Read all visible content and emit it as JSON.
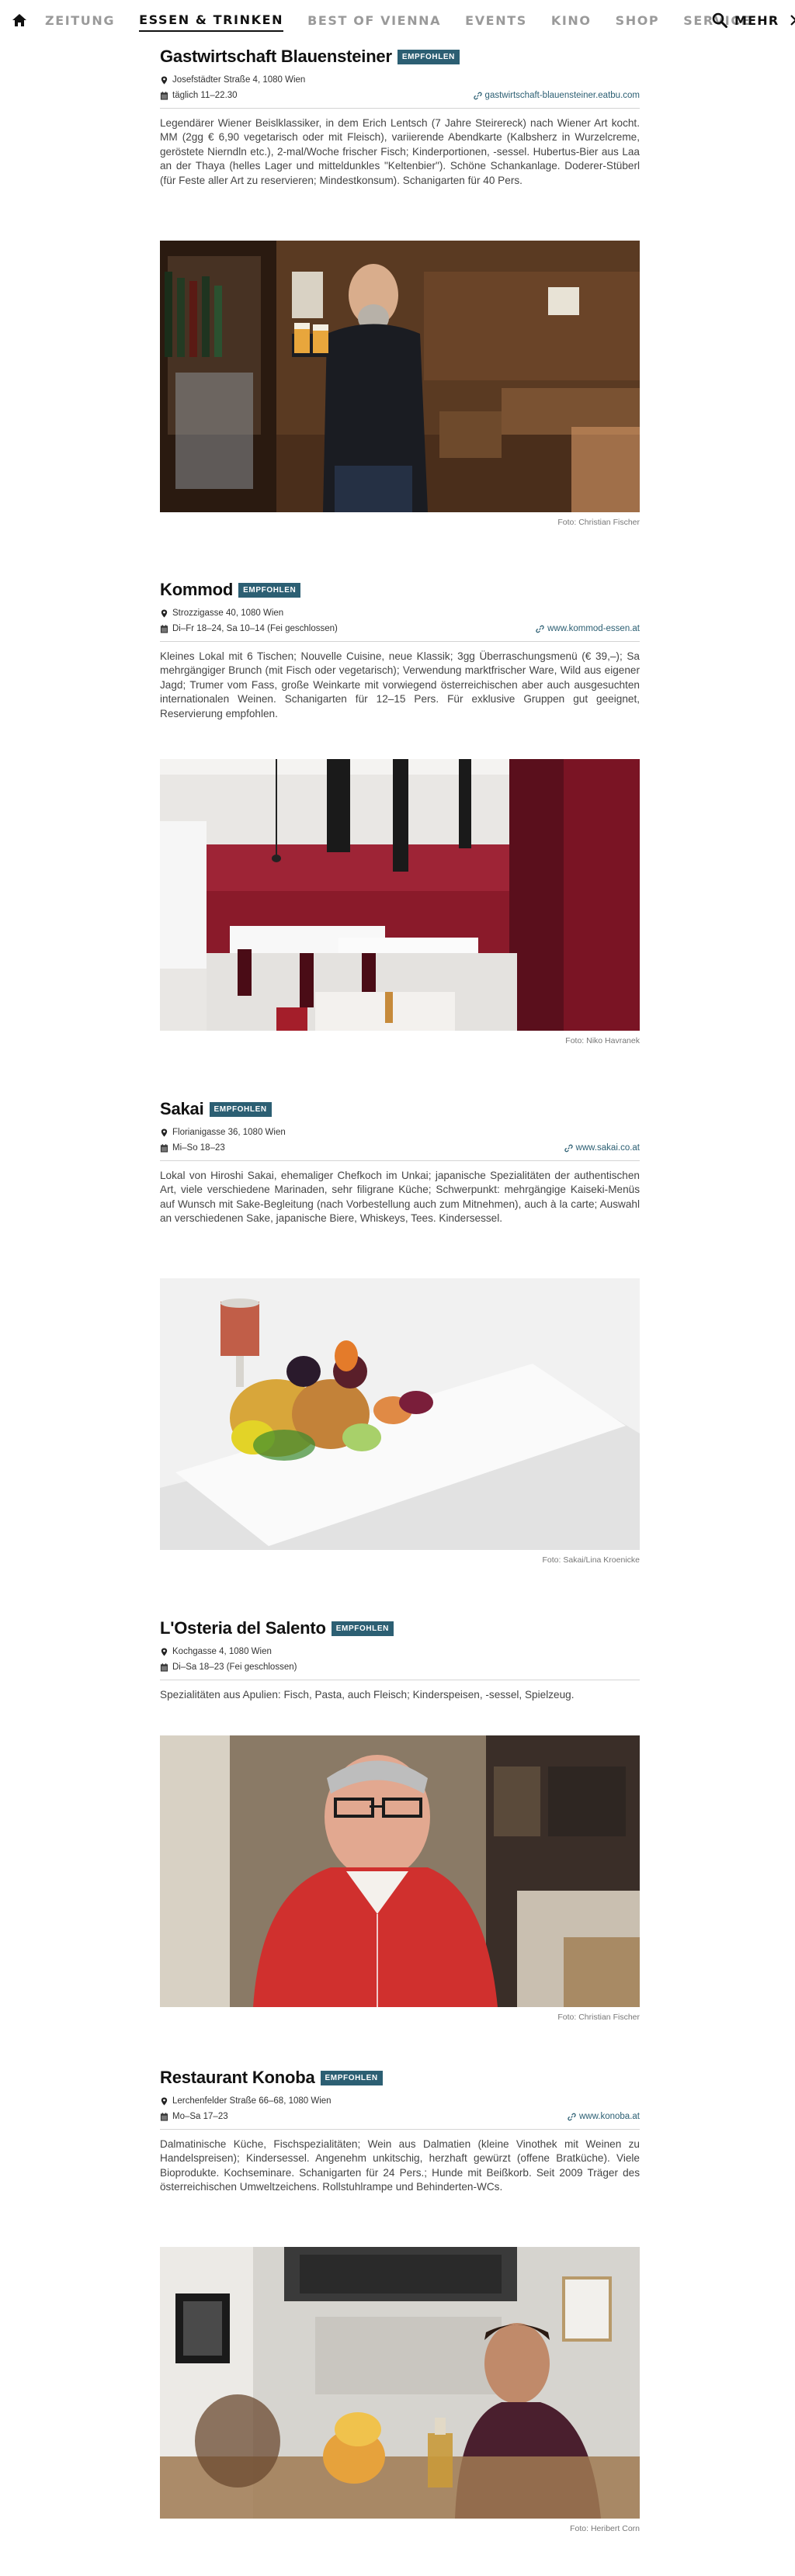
{
  "nav": {
    "items": [
      {
        "label": "ZEITUNG",
        "active": false
      },
      {
        "label": "ESSEN & TRINKEN",
        "active": true
      },
      {
        "label": "BEST OF VIENNA",
        "active": false
      },
      {
        "label": "EVENTS",
        "active": false
      },
      {
        "label": "KINO",
        "active": false
      },
      {
        "label": "SHOP",
        "active": false
      },
      {
        "label": "SERVICE",
        "active": false
      }
    ],
    "more_label": "MEHR",
    "icons": {
      "home": "home-icon",
      "search": "search-icon",
      "more": "chevron-right-icon"
    }
  },
  "colors": {
    "badge": "#2c5f73",
    "link": "#2c5f73",
    "nav_inactive": "#9a9a9a",
    "nav_active": "#111111"
  },
  "entries": [
    {
      "name": "Gastwirtschaft Blauensteiner",
      "badge": "EMPFOHLEN",
      "address": "Josefstädter Straße 4, 1080 Wien",
      "hours": "täglich 11–22.30",
      "website": "gastwirtschaft-blauensteiner.eatbu.com",
      "description": "Legendärer Wiener Beislklassiker, in dem Erich Lentsch (7 Jahre Steirereck) nach Wiener Art kocht. MM (2gg € 6,90 vegetarisch oder mit Fleisch), variierende Abendkarte (Kalbsherz in Wurzelcreme, geröstete Nierndln etc.), 2-mal/Woche frischer Fisch; Kinderportionen, -sessel. Hubertus-Bier aus Laa an der Thaya (helles Lager und mitteldunkles \"Keltenbier\"). Schöne Schankanlage. Doderer-Stüberl (für Feste aller Art zu reservieren; Mindestkonsum). Schanigarten für 40 Pers.",
      "photo_credit": "Foto: Christian Fischer"
    },
    {
      "name": "Kommod",
      "badge": "EMPFOHLEN",
      "address": "Strozzigasse 40, 1080 Wien",
      "hours": "Di–Fr 18–24, Sa 10–14 (Fei geschlossen)",
      "website": "www.kommod-essen.at",
      "description": "Kleines Lokal mit 6 Tischen; Nouvelle Cuisine, neue Klassik; 3gg Überraschungsmenü (€ 39,–); Sa mehrgängiger Brunch (mit Fisch oder vegetarisch); Verwendung marktfrischer Ware, Wild aus eigener Jagd; Trumer vom Fass, große Weinkarte mit vorwiegend österreichischen aber auch ausgesuchten internationalen Weinen. Schanigarten für 12–15 Pers. Für exklusive Gruppen gut geeignet, Reservierung empfohlen.",
      "photo_credit": "Foto: Niko Havranek"
    },
    {
      "name": "Sakai",
      "badge": "EMPFOHLEN",
      "address": "Florianigasse 36, 1080 Wien",
      "hours": "Mi–So 18–23",
      "website": "www.sakai.co.at",
      "description": "Lokal von Hiroshi Sakai, ehemaliger Chefkoch im Unkai; japanische Spezialitäten der authentischen Art, viele verschiedene Marinaden, sehr filigrane Küche; Schwerpunkt: mehrgängige Kaiseki-Menüs auf Wunsch mit Sake-Begleitung (nach Vorbestellung auch zum Mitnehmen), auch à la carte; Auswahl an verschiedenen Sake, japanische Biere, Whiskeys, Tees. Kindersessel.",
      "photo_credit": "Foto: Sakai/Lina Kroenicke"
    },
    {
      "name": "L'Osteria del Salento",
      "badge": "EMPFOHLEN",
      "address": "Kochgasse 4, 1080 Wien",
      "hours": "Di–Sa 18–23 (Fei geschlossen)",
      "website": "",
      "description": "Spezialitäten aus Apulien: Fisch, Pasta, auch Fleisch; Kinderspeisen, -sessel, Spielzeug.",
      "photo_credit": "Foto: Christian Fischer"
    },
    {
      "name": "Restaurant Konoba",
      "badge": "EMPFOHLEN",
      "address": "Lerchenfelder Straße 66–68, 1080 Wien",
      "hours": "Mo–Sa 17–23",
      "website": "www.konoba.at",
      "description": "Dalmatinische Küche, Fischspezialitäten; Wein aus Dalmatien (kleine Vinothek mit Weinen zu Handelspreisen); Kindersessel. Angenehm unkitschig, herzhaft gewürzt (offene Bratküche). Viele Bioprodukte. Kochseminare. Schanigarten für 24 Pers.; Hunde mit Beißkorb. Seit 2009 Träger des österreichischen Umweltzeichens. Rollstuhlrampe und Behinderten-WCs.",
      "photo_credit": "Foto: Heribert Corn"
    }
  ]
}
